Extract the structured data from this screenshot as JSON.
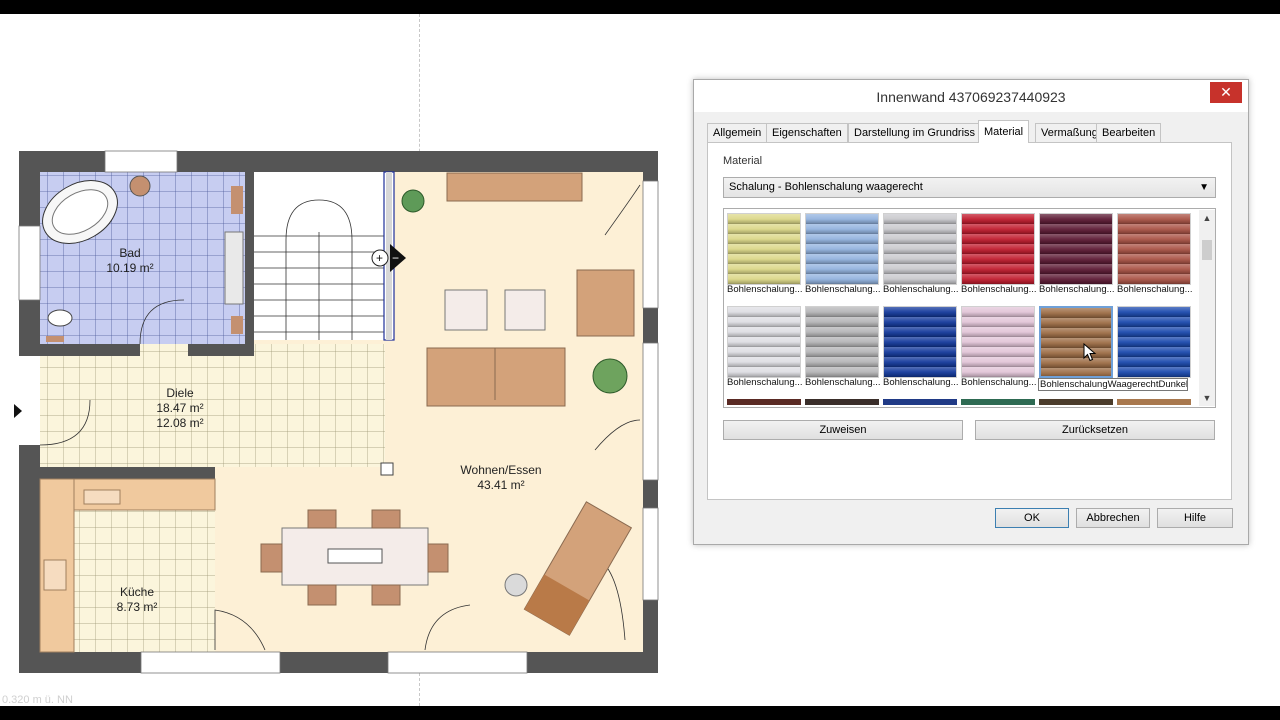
{
  "plan": {
    "rooms": [
      {
        "name": "Bad",
        "area": "10.19 m²"
      },
      {
        "name": "Diele",
        "area": "18.47 m²",
        "area2": "12.08 m²"
      },
      {
        "name": "Wohnen/Essen",
        "area": "43.41 m²"
      },
      {
        "name": "Küche",
        "area": "8.73 m²"
      }
    ],
    "elevation_label": "0.320 m ü. NN"
  },
  "dialog": {
    "title": "Innenwand 437069237440923",
    "close_label": "✕",
    "tabs": [
      {
        "label": "Allgemein",
        "active": false
      },
      {
        "label": "Eigenschaften",
        "active": false
      },
      {
        "label": "Darstellung im Grundriss",
        "active": false
      },
      {
        "label": "Material",
        "active": true
      },
      {
        "label": "Vermaßung",
        "active": false
      },
      {
        "label": "Bearbeiten",
        "active": false
      }
    ],
    "material_label": "Material",
    "material_value": "Schalung - Bohlenschalung waagerecht",
    "swatches": [
      {
        "label": "Bohlenschalung...",
        "color": "#dcd889"
      },
      {
        "label": "Bohlenschalung...",
        "color": "#93b3df"
      },
      {
        "label": "Bohlenschalung...",
        "color": "#c9c9cd"
      },
      {
        "label": "Bohlenschalung...",
        "color": "#c11d2f"
      },
      {
        "label": "Bohlenschalung...",
        "color": "#5e1c36"
      },
      {
        "label": "Bohlenschalung...",
        "color": "#aa5447"
      },
      {
        "label": "Bohlenschalung...",
        "color": "#dedee3"
      },
      {
        "label": "Bohlenschalung...",
        "color": "#b5b5b7"
      },
      {
        "label": "Bohlenschalung...",
        "color": "#143a9c"
      },
      {
        "label": "Bohlenschalung...",
        "color": "#e2c5d8"
      },
      {
        "label": "BohlenschalungWaagerechtDunkel...",
        "color": "#9c6c45",
        "selected": true
      },
      {
        "label": "",
        "color": "#1c4aae"
      }
    ],
    "buttons": {
      "assign": "Zuweisen",
      "reset": "Zurücksetzen",
      "ok": "OK",
      "cancel": "Abbrechen",
      "help": "Hilfe"
    }
  }
}
